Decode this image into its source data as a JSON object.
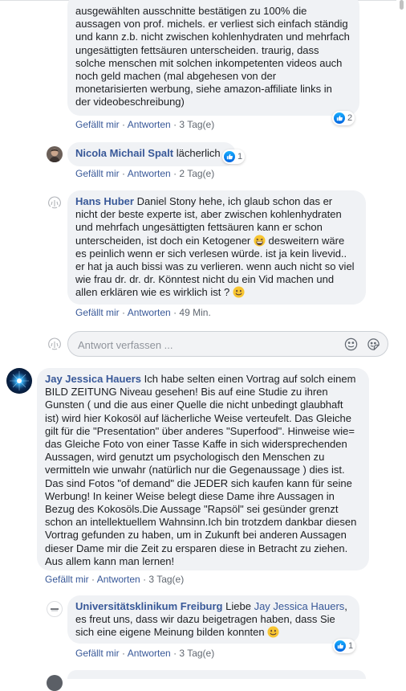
{
  "actions": {
    "like": "Gefällt mir",
    "reply": "Antworten",
    "separator": "·"
  },
  "comments": [
    {
      "text": "ausgewählten ausschnitte bestätigen zu 100% die aussagen von prof. michels. er verliest sich einfach ständig und kann z.b. nicht zwischen kohlenhydraten und mehrfach ungesättigten fettsäuren unterscheiden. traurig, dass solche menschen mit solchen inkompetenten videos auch noch geld machen (mal abgehesen von der monetarisierten werbung, siehe amazon-affiliate links in der videobeschreibung)",
      "time": "3 Tag(e)",
      "reactions": "2"
    },
    {
      "author": "Nicola Michail Spalt",
      "text": "lächerlich",
      "time": "2 Tag(e)",
      "reactions": "1"
    },
    {
      "author": "Hans Huber",
      "text_a": "Daniel Stony hehe, ich glaub schon das er nicht der beste experte ist, aber zwischen kohlenhydraten und mehrfach ungesättigten fettsäuren kann er schon unterscheiden, ist doch ein Ketogener",
      "text_b": "desweitern wäre es peinlich wenn er sich verlesen würde. ist ja kein livevid.. er hat ja auch bissi was zu verlieren. wenn auch nicht so viel wie frau dr. dr. dr. Könntest nicht du ein Vid machen und allen erklären wie es wirklich ist ?",
      "time": "49 Min."
    }
  ],
  "reply_box": {
    "placeholder": "Antwort verfassen ..."
  },
  "main_comment": {
    "author": "Jay Jessica Hauers",
    "text": "Ich habe selten einen Vortrag auf solch einem BILD ZEITUNG Niveau gesehen! Bis auf eine Studie zu ihren Gunsten ( und die aus einer Quelle die nicht unbedingt glaubhaft ist) wird hier Kokosöl auf lächerliche Weise verteufelt. Das Gleiche gilt für die \"Presentation\" über anderes \"Superfood\". Hinweise wie= das Gleiche Foto von einer Tasse Kaffe in sich widersprechenden Aussagen, wird genutzt um psychologisch den Menschen zu vermitteln wie unwahr (natürlich nur die Gegenaussage ) dies ist. Das sind Fotos \"of demand\" die JEDER sich kaufen kann für seine Werbung! In keiner Weise belegt diese Dame ihre Aussagen in Bezug des Kokosöls.Die Aussage \"Rapsöl\" sei gesünder grenzt schon an intellektuellem Wahnsinn.Ich bin trotzdem dankbar diesen Vortrag gefunden zu haben, um in Zukunft bei anderen Aussagen dieser Dame mir die Zeit zu ersparen diese in Betracht zu ziehen. Aus allem kann man lernen!",
    "time": "3 Tag(e)"
  },
  "uni_reply": {
    "author": "Universitätsklinikum Freiburg",
    "text_a": "Liebe",
    "mention": "Jay Jessica Hauers",
    "text_b": ", es freut uns, dass wir dazu beigetragen haben, dass Sie sich eine eigene Meinung bilden konnten",
    "time": "3 Tag(e)",
    "reactions": "1"
  },
  "colors": {
    "link": "#385898",
    "bubble": "#f0f2f5",
    "meta": "#606770",
    "like": "#1877f2"
  }
}
